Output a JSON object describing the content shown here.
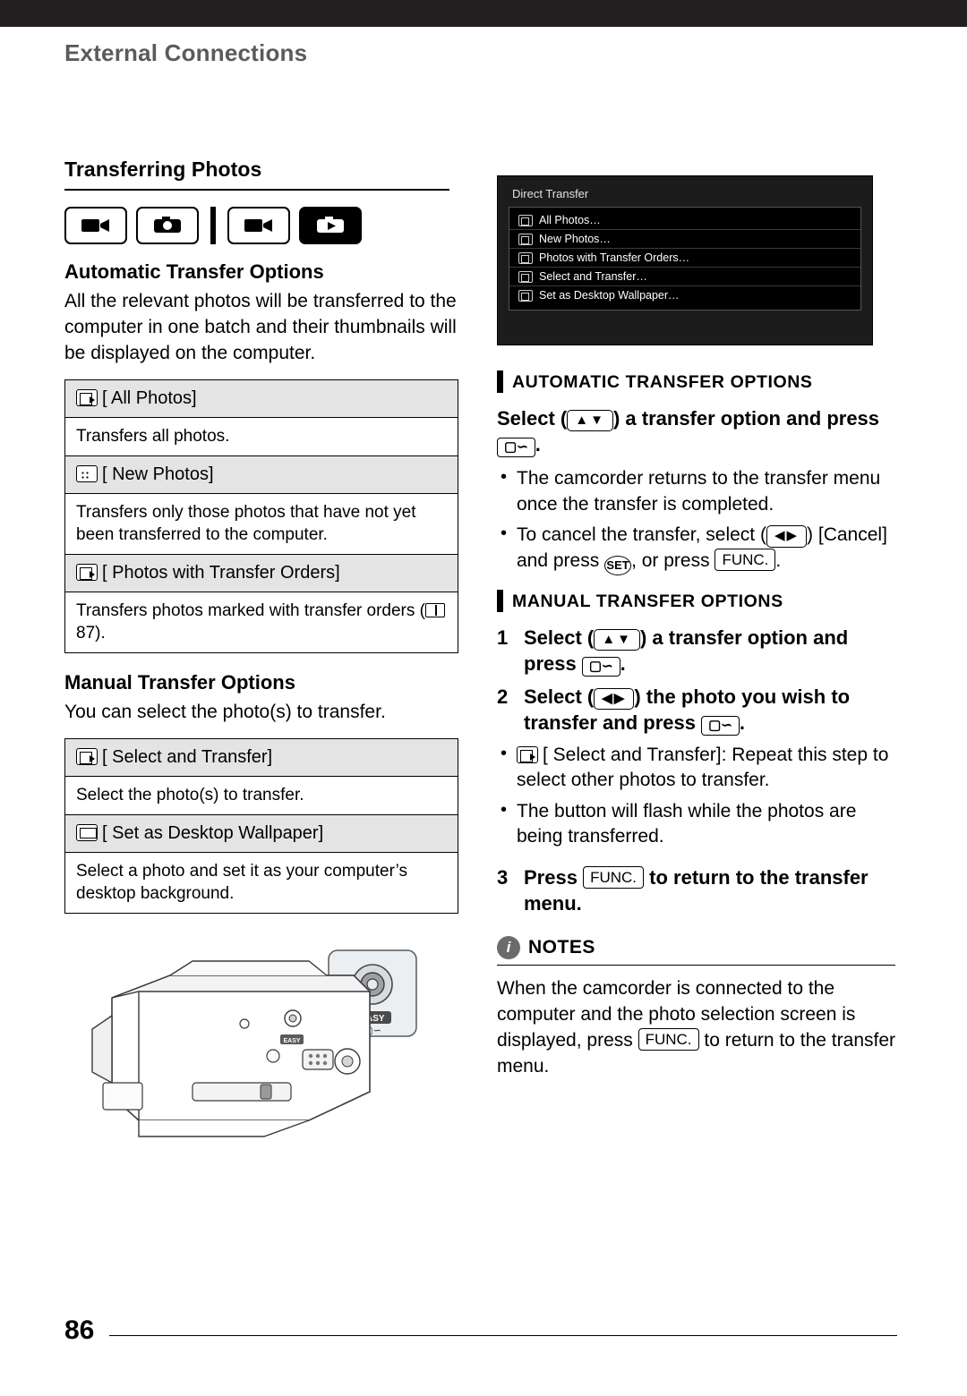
{
  "header": {
    "chapter": "External Connections",
    "page_number": "86"
  },
  "left": {
    "section_title": "Transferring Photos",
    "mode_icons": [
      "movie-camera-icon",
      "photo-camera-icon",
      "movie-playback-icon",
      "photo-playback-icon"
    ],
    "auto": {
      "title": "Automatic Transfer Options",
      "body": "All the relevant photos will be transferred to the computer in one batch and their thumbnails will be displayed on the computer.",
      "rows": [
        {
          "label": "[ All Photos]",
          "desc": "Transfers all photos."
        },
        {
          "label": "[ New Photos]",
          "desc": "Transfers only those photos that have not yet been transferred to the computer."
        },
        {
          "label": "[ Photos with Transfer Orders]",
          "desc": "Transfers photos marked with transfer orders (",
          "desc_after": " 87)."
        }
      ]
    },
    "manual": {
      "title": "Manual Transfer Options",
      "body": "You can select the photo(s) to transfer.",
      "rows": [
        {
          "label": "[ Select and Transfer]",
          "desc": "Select the photo(s) to transfer."
        },
        {
          "label": "[ Set as Desktop Wallpaper]",
          "desc": "Select a photo and set it as your computer’s desktop background."
        }
      ]
    }
  },
  "right": {
    "screenshot": {
      "title": "Direct Transfer",
      "items": [
        "All Photos…",
        "New Photos…",
        "Photos with Transfer Orders…",
        "Select and Transfer…",
        "Set as Desktop Wallpaper…"
      ]
    },
    "auto_heading": "AUTOMATIC TRANSFER OPTIONS",
    "auto_instruction_a": "Select (",
    "auto_instruction_b": ") a transfer option and press",
    "auto_bullets": [
      "The camcorder returns to the transfer menu once the transfer is completed.",
      "To cancel the transfer, select ("
    ],
    "cancel_rest_1": ") [Cancel] and press",
    "cancel_rest_2": ", or press",
    "func_key": "FUNC.",
    "set_key": "SET",
    "updown_key": "▲▼",
    "leftright_key": "◀▶",
    "manual_heading": "MANUAL TRANSFER OPTIONS",
    "manual_steps": [
      {
        "n": "1",
        "text_a": "Select (",
        "text_b": ") a transfer option and press",
        "key": "print-share-button"
      },
      {
        "n": "2",
        "text_a": "Select (",
        "text_b": ") the photo you wish to transfer and press",
        "key": "print-share-button"
      },
      {
        "n": "3",
        "text_a": "Press",
        "text_b": "to return to the transfer menu.",
        "key": "FUNC."
      }
    ],
    "manual_bullets": [
      "[ Select and Transfer]: Repeat this step to select other photos to transfer.",
      "The  button will flash while the photos are being transferred."
    ],
    "notes_title": "NOTES",
    "notes_body_a": "When the camcorder is connected to the computer and the photo selection screen is displayed, press",
    "notes_body_b": "to return to the transfer menu."
  },
  "camcorder": {
    "easy_label": "EASY",
    "print_label": "print-share-icon"
  }
}
